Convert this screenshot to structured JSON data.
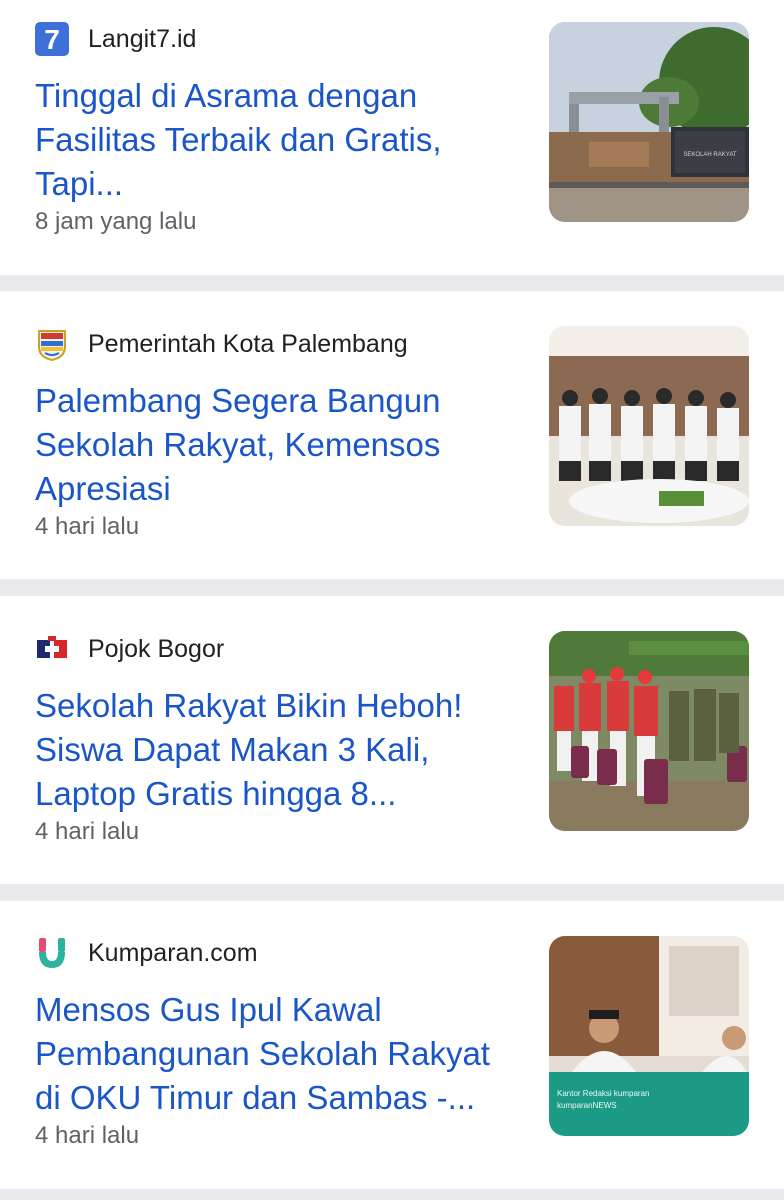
{
  "articles": [
    {
      "source": "Langit7.id",
      "source_icon": "langit7-logo-icon",
      "headline_lines": [
        "Tinggal di Asrama dengan",
        "Fasilitas Terbaik dan Gratis,",
        "Tapi..."
      ],
      "time": "8 jam yang lalu",
      "thumbnail": "school-gate-photo",
      "thumbnail_text": "SEKOLAH RAKYAT"
    },
    {
      "source": "Pemerintah Kota Palembang",
      "source_icon": "palembang-emblem-icon",
      "headline_lines": [
        "Palembang Segera Bangun",
        "Sekolah Rakyat, Kemensos",
        "Apresiasi"
      ],
      "time": "4 hari lalu",
      "thumbnail": "officials-group-photo"
    },
    {
      "source": "Pojok Bogor",
      "source_icon": "pojok-bogor-logo-icon",
      "headline_lines": [
        "Sekolah Rakyat Bikin Heboh!",
        "Siswa Dapat Makan 3 Kali,",
        "Laptop Gratis hingga 8..."
      ],
      "time": "4 hari lalu",
      "thumbnail": "students-red-uniform-photo"
    },
    {
      "source": "Kumparan.com",
      "source_icon": "kumparan-logo-icon",
      "headline_lines": [
        "Mensos Gus Ipul Kawal",
        "Pembangunan Sekolah Rakyat",
        "di OKU Timur dan Sambas -..."
      ],
      "time": "4 hari lalu",
      "thumbnail": "minister-meeting-photo",
      "thumbnail_text": "Kantor Redaksi kumparan",
      "thumbnail_text2": "kumparanNEWS"
    }
  ],
  "colors": {
    "headline": "#1a56c8",
    "source": "#202124",
    "time": "#5f6368",
    "separator": "#e8eaed"
  }
}
